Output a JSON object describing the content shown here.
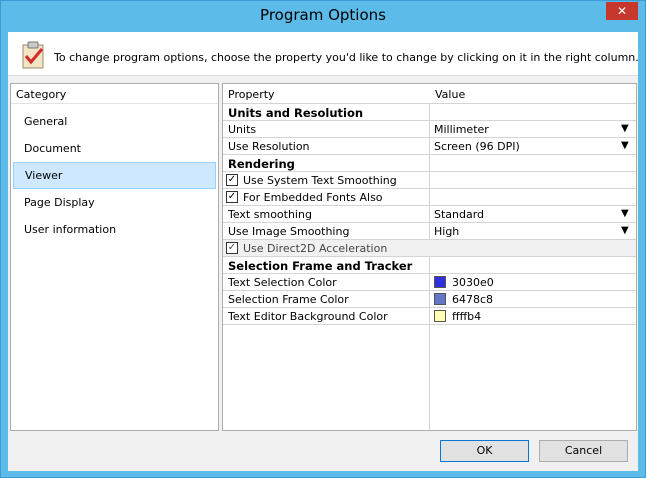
{
  "window": {
    "title": "Program Options",
    "close_glyph": "✕"
  },
  "header": {
    "icon": "clipboard-check-icon",
    "text": "To change program options, choose the property you'd like to change by clicking on it in the right column."
  },
  "category": {
    "header": "Category",
    "items": [
      {
        "label": "General"
      },
      {
        "label": "Document"
      },
      {
        "label": "Viewer"
      },
      {
        "label": "Page Display"
      },
      {
        "label": "User information"
      }
    ],
    "selected": "Viewer"
  },
  "grid": {
    "headers": {
      "property": "Property",
      "value": "Value"
    },
    "sections": {
      "units": "Units and Resolution",
      "rendering": "Rendering",
      "selection": "Selection Frame and Tracker"
    },
    "rows": {
      "units": {
        "label": "Units",
        "value": "Millimeter"
      },
      "resolution": {
        "label": "Use Resolution",
        "value": "Screen (96 DPI)"
      },
      "system_smoothing": {
        "label": "Use System Text Smoothing",
        "checked": true
      },
      "embedded_fonts": {
        "label": "For Embedded Fonts Also",
        "checked": true
      },
      "text_smoothing": {
        "label": "Text smoothing",
        "value": "Standard"
      },
      "image_smoothing": {
        "label": "Use Image Smoothing",
        "value": "High"
      },
      "direct2d": {
        "label": "Use Direct2D Acceleration",
        "checked": true
      },
      "text_sel_color": {
        "label": "Text Selection Color",
        "value": "3030e0",
        "color": "#3030e0"
      },
      "sel_frame_color": {
        "label": "Selection Frame Color",
        "value": "6478c8",
        "color": "#6478c8"
      },
      "editor_bg_color": {
        "label": "Text Editor Background Color",
        "value": "ffffb4",
        "color": "#ffffb4"
      }
    },
    "dropdown_glyph": "▼",
    "check_glyph": "✓"
  },
  "buttons": {
    "ok": "OK",
    "cancel": "Cancel"
  }
}
